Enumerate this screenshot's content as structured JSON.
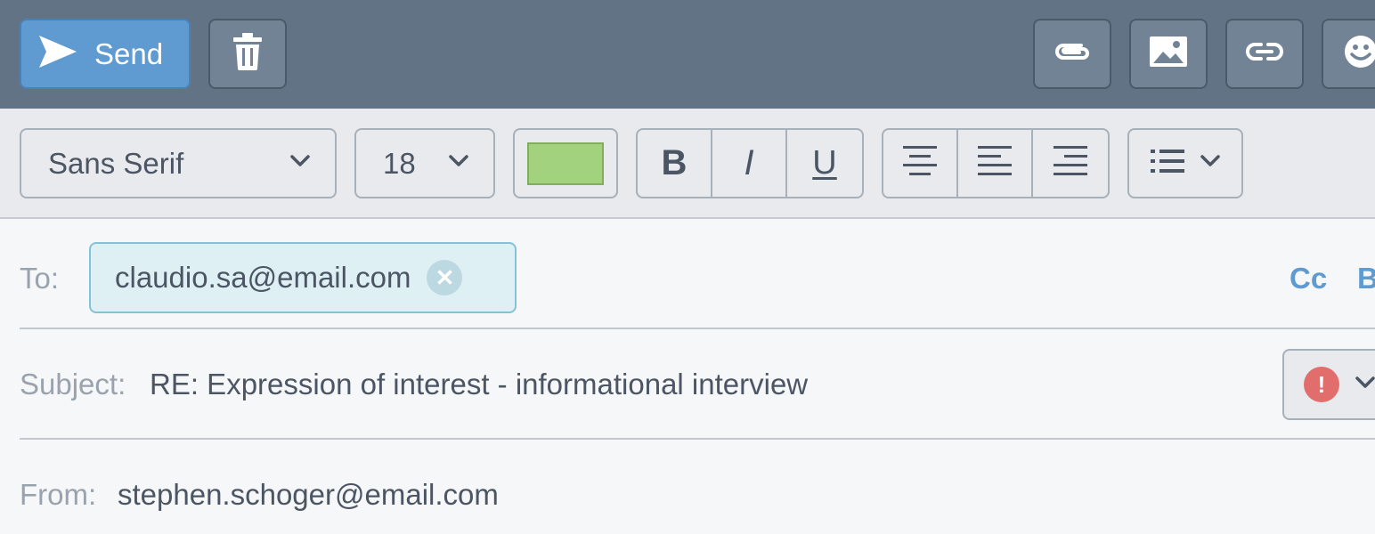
{
  "toolbar": {
    "send_label": "Send",
    "icons": [
      "send-icon",
      "trash-icon",
      "paperclip-icon",
      "image-icon",
      "link-icon",
      "emoji-icon"
    ]
  },
  "format": {
    "font_family": "Sans Serif",
    "font_size": "18",
    "text_color": "#a3d27f",
    "bold": "B",
    "italic": "I",
    "underline": "U"
  },
  "fields": {
    "to_label": "To:",
    "to_recipient": "claudio.sa@email.com",
    "cc_label": "Cc",
    "bcc_label": "B",
    "subject_label": "Subject:",
    "subject_value": "RE: Expression of interest - informational interview",
    "priority_icon": "!",
    "from_label": "From:",
    "from_value": "stephen.schoger@email.com"
  },
  "colors": {
    "toolbar_bg": "#627385",
    "accent": "#5f9bd1",
    "chip_bg": "#dff0f5",
    "priority": "#e26d6d"
  }
}
